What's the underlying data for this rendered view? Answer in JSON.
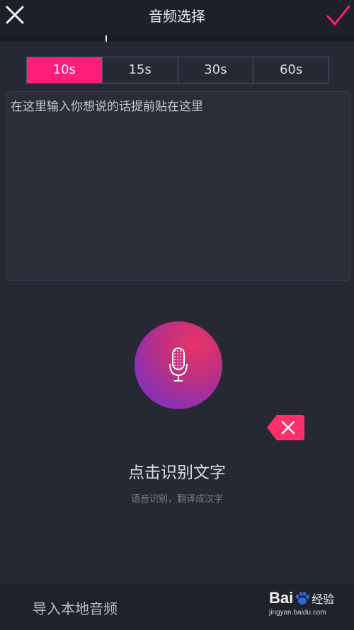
{
  "header": {
    "title": "音频选择",
    "close_icon": "close-icon",
    "confirm_icon": "check-icon",
    "accent_color": "#ff1e7a"
  },
  "duration_tabs": {
    "options": [
      "10s",
      "15s",
      "30s",
      "60s"
    ],
    "selected": "10s"
  },
  "text_input": {
    "value": "在这里输入你想说的话提前贴在这里"
  },
  "recognition": {
    "mic_icon": "microphone-icon",
    "delete_icon": "delete-icon",
    "label": "点击识别文字",
    "hint": "语音识别，翻译成汉字"
  },
  "bottom_bar": {
    "import_label": "导入本地音频"
  },
  "watermark": {
    "brand": "Bai",
    "suffix": "经验",
    "url": "jingyan.baidu.com"
  }
}
